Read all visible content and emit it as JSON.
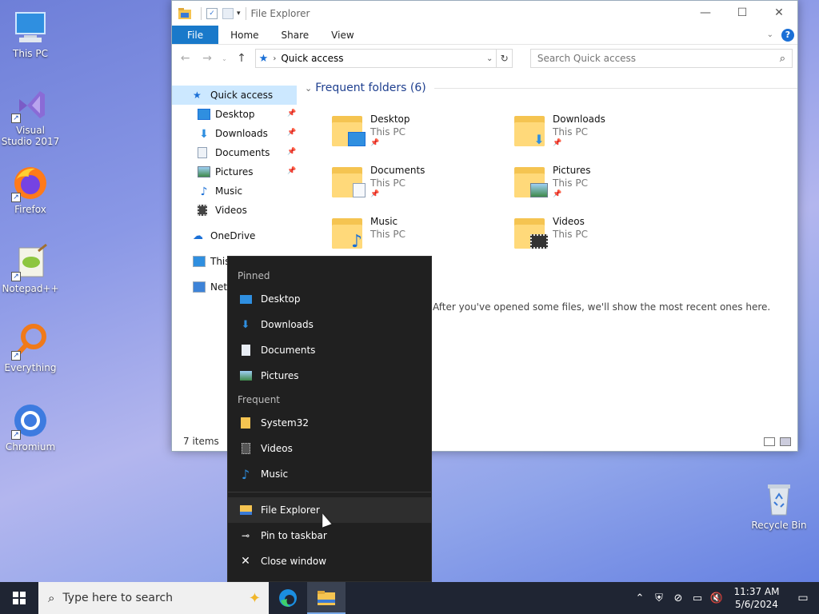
{
  "desktop": {
    "icons": [
      {
        "label": "This PC"
      },
      {
        "label": "Visual Studio 2017"
      },
      {
        "label": "Firefox"
      },
      {
        "label": "Notepad++"
      },
      {
        "label": "Everything"
      },
      {
        "label": "Chromium"
      },
      {
        "label": "Recycle Bin"
      }
    ]
  },
  "explorer": {
    "title": "File Explorer",
    "controls": {
      "minimize": "—",
      "maximize": "☐",
      "close": "✕"
    },
    "ribbon_tabs": [
      "File",
      "Home",
      "Share",
      "View"
    ],
    "help": "?",
    "address": {
      "crumb": "Quick access"
    },
    "search": {
      "placeholder": "Search Quick access"
    },
    "nav": {
      "quick_access": "Quick access",
      "pinned": [
        "Desktop",
        "Downloads",
        "Documents",
        "Pictures"
      ],
      "other": [
        "Music",
        "Videos"
      ],
      "onedrive": "OneDrive",
      "this_pc": "This PC",
      "network": "Network"
    },
    "frequent_header": "Frequent folders (6)",
    "folders": [
      {
        "name": "Desktop",
        "location": "This PC",
        "pinned": true
      },
      {
        "name": "Downloads",
        "location": "This PC",
        "pinned": true
      },
      {
        "name": "Documents",
        "location": "This PC",
        "pinned": true
      },
      {
        "name": "Pictures",
        "location": "This PC",
        "pinned": true
      },
      {
        "name": "Music",
        "location": "This PC",
        "pinned": false
      },
      {
        "name": "Videos",
        "location": "This PC",
        "pinned": false
      }
    ],
    "recent_message": "After you've opened some files, we'll show the most recent ones here.",
    "status": "7 items"
  },
  "jumplist": {
    "pinned_header": "Pinned",
    "pinned": [
      "Desktop",
      "Downloads",
      "Documents",
      "Pictures"
    ],
    "frequent_header": "Frequent",
    "frequent": [
      "System32",
      "Videos",
      "Music"
    ],
    "actions": [
      "File Explorer",
      "Pin to taskbar",
      "Close window"
    ]
  },
  "taskbar": {
    "search_placeholder": "Type here to search",
    "time": "11:37 AM",
    "date": "5/6/2024"
  },
  "colors": {
    "accent": "#1979ca",
    "jumplist_bg": "#202020",
    "taskbar_bg": "#1f2533",
    "nav_selected": "#cce8ff"
  }
}
